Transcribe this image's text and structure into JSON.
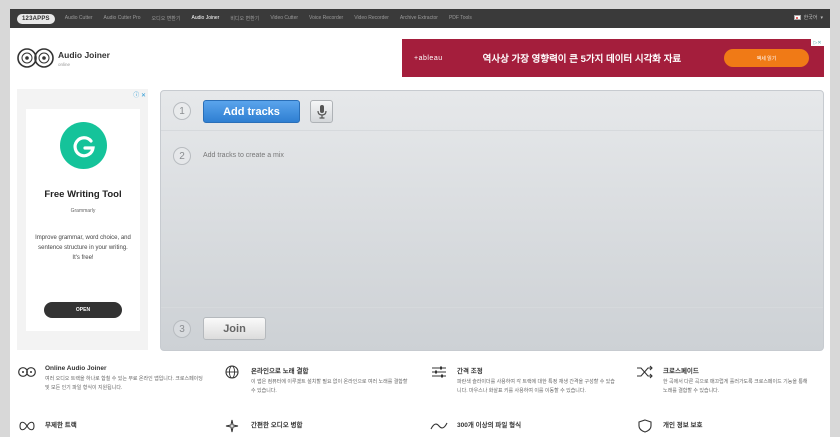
{
  "nav": {
    "brand": "123APPS",
    "items": [
      "Audio Cutter",
      "Audio Cutter Pro",
      "오디오 변환기",
      "Audio Joiner",
      "비디오 변환기",
      "Video Cutter",
      "Voice Recorder",
      "Video Recorder",
      "Archive Extractor",
      "PDF Tools"
    ],
    "active_index": 3,
    "language": "한국어"
  },
  "app": {
    "title": "Audio Joiner",
    "subtitle": "online"
  },
  "top_ad": {
    "brand": "+ableau",
    "headline": "역사상 가장 영향력이 큰 5가지 데이터 시각화 자료",
    "button": "액세 읽기",
    "corner": "▷✕",
    "color": "#a41e3c"
  },
  "side_ad": {
    "controls": "ⓘ ✕",
    "title": "Free Writing Tool",
    "brand": "Grammarly",
    "description": "Improve grammar, word choice, and sentence structure in your writing. It's free!",
    "button": "OPEN",
    "icon_letter": "G",
    "color": "#15c39a"
  },
  "joiner": {
    "step1": "1",
    "step2": "2",
    "step3": "3",
    "add_tracks": "Add tracks",
    "hint": "Add tracks to create a mix",
    "join": "Join",
    "accent": "#2f7fd2"
  },
  "features": [
    {
      "icon": "disc-icon",
      "title": "Online Audio Joiner",
      "desc": "여러 오디오 트랙을 하나로 합칠 수 있는 무료 온라인 앱입니다. 크로스페이딩 및 모든 인기 파일 형식이 지원됩니다."
    },
    {
      "icon": "globe-icon",
      "title": "온라인으로 노래 결합",
      "desc": "이 앱은 컴퓨터에 이루겠트 설치할 필요 없이 온라인으로 여러 노래를 결합할 수 있습니다."
    },
    {
      "icon": "sliders-icon",
      "title": "간격 조정",
      "desc": "파란색 슬라이더를 사용하여 각 트랙에 대한 특정 재생 간격을 구성할 수 있습니다. 마우스나 화살표 키를 사용하여 이를 이동할 수 있습니다."
    },
    {
      "icon": "shuffle-icon",
      "title": "크로스페이드",
      "desc": "한 곡에서 다른 곡으로 매끄럽게 흘러가도록 크로스페이드 기능을 통해 노래를 결합할 수 있습니다."
    }
  ],
  "features2": [
    {
      "icon": "infinity-icon",
      "title": "무제한 트랙"
    },
    {
      "icon": "sparkle-icon",
      "title": "간편한 오디오 병합"
    },
    {
      "icon": "wave-icon",
      "title": "300개 이상의 파일 형식"
    },
    {
      "icon": "shield-icon",
      "title": "개인 정보 보호"
    }
  ]
}
